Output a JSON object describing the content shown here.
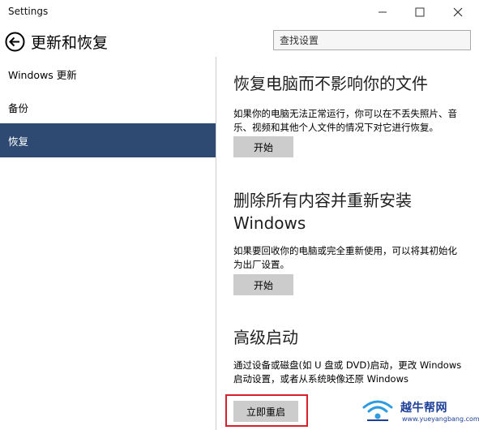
{
  "window": {
    "title": "Settings"
  },
  "header": {
    "page_title": "更新和恢复",
    "search_placeholder": "查找设置"
  },
  "sidebar": {
    "items": [
      {
        "label": "Windows 更新",
        "selected": false
      },
      {
        "label": "备份",
        "selected": false
      },
      {
        "label": "恢复",
        "selected": true
      }
    ]
  },
  "content": {
    "sections": [
      {
        "heading": "恢复电脑而不影响你的文件",
        "description": "如果你的电脑无法正常运行，你可以在不丢失照片、音乐、视频和其他个人文件的情况下对它进行恢复。",
        "button": "开始"
      },
      {
        "heading": "删除所有内容并重新安装 Windows",
        "description": "如果要回收你的电脑或完全重新使用，可以将其初始化为出厂设置。",
        "button": "开始"
      },
      {
        "heading": "高级启动",
        "description": "通过设备或磁盘(如 U 盘或 DVD)启动，更改 Windows 启动设置，或者从系统映像还原 Windows",
        "button": "立即重启"
      }
    ]
  },
  "watermark": {
    "title": "越牛帮网",
    "url": "www.yueyangbang.com"
  },
  "colors": {
    "selected_nav": "#2e4a72",
    "button_bg": "#cccccc",
    "highlight_border": "#d8202a",
    "watermark": "#1c3f9a"
  },
  "icons": {
    "minimize": "minimize-icon",
    "maximize": "maximize-icon",
    "close": "close-icon",
    "back": "back-arrow-icon"
  }
}
